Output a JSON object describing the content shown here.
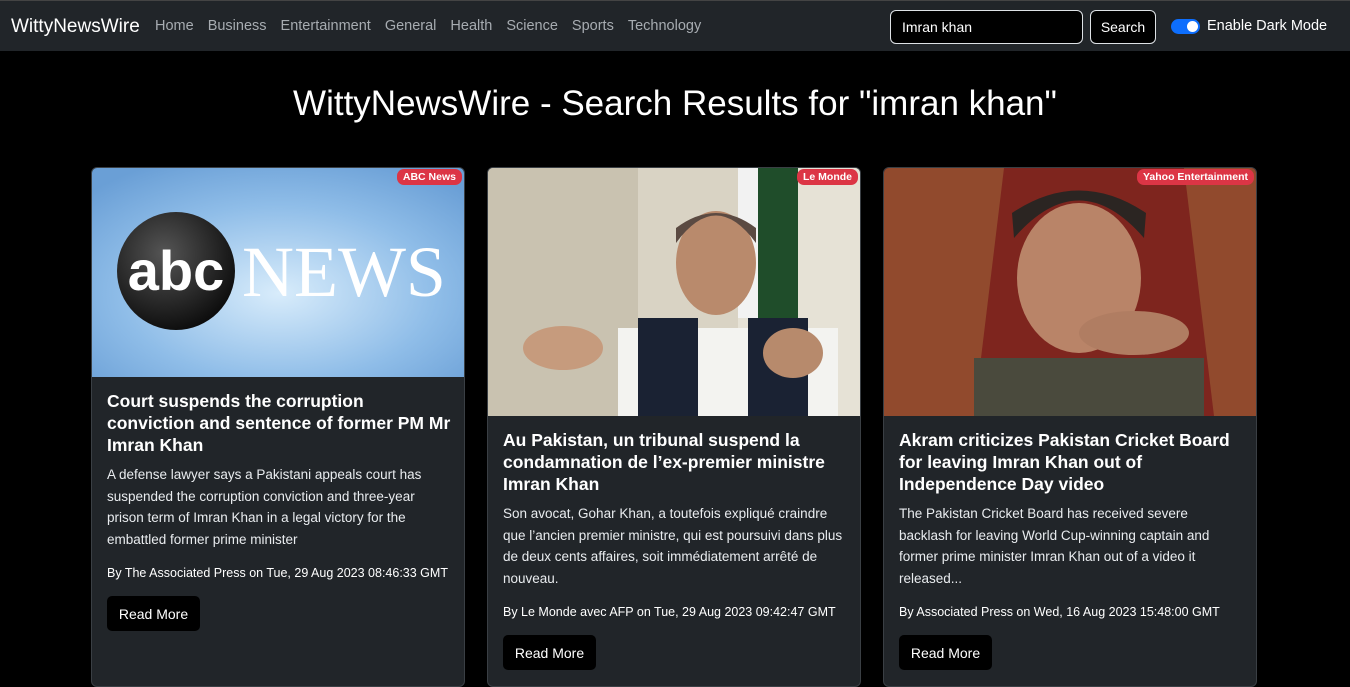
{
  "nav": {
    "brand": "WittyNewsWire",
    "links": [
      "Home",
      "Business",
      "Entertainment",
      "General",
      "Health",
      "Science",
      "Sports",
      "Technology"
    ],
    "search_value": "Imran khan",
    "search_button": "Search",
    "dark_mode_label": "Enable Dark Mode",
    "dark_mode_enabled": true
  },
  "page": {
    "title": "WittyNewsWire - Search Results for \"imran khan\""
  },
  "articles": [
    {
      "source": "ABC News",
      "title": "Court suspends the corruption conviction and sentence of former PM Mr Imran Khan",
      "description": "A defense lawyer says a Pakistani appeals court has suspended the corruption conviction and three-year prison term of Imran Khan in a legal victory for the embattled former prime minister",
      "meta": "By The Associated Press on Tue, 29 Aug 2023 08:46:33 GMT",
      "read_more": "Read More",
      "image_logo_text": "abc",
      "image_logo_word": "NEWS"
    },
    {
      "source": "Le Monde",
      "title": "Au Pakistan, un tribunal suspend la condamnation de l’ex-premier ministre Imran Khan",
      "description": "Son avocat, Gohar Khan, a toutefois expliqué craindre que l’ancien premier ministre, qui est poursuivi dans plus de deux cents affaires, soit immédiatement arrêté de nouveau.",
      "meta": "By Le Monde avec AFP on Tue, 29 Aug 2023 09:42:47 GMT",
      "read_more": "Read More"
    },
    {
      "source": "Yahoo Entertainment",
      "title": "Akram criticizes Pakistan Cricket Board for leaving Imran Khan out of Independence Day video",
      "description": "The Pakistan Cricket Board has received severe backlash for leaving World Cup-winning captain and former prime minister Imran Khan out of a video it released...",
      "meta": "By Associated Press on Wed, 16 Aug 2023 15:48:00 GMT",
      "read_more": "Read More"
    }
  ],
  "colors": {
    "navbar_bg": "#212529",
    "card_bg": "#212529",
    "badge_bg": "#dc3545",
    "toggle_on": "#0d6efd"
  }
}
